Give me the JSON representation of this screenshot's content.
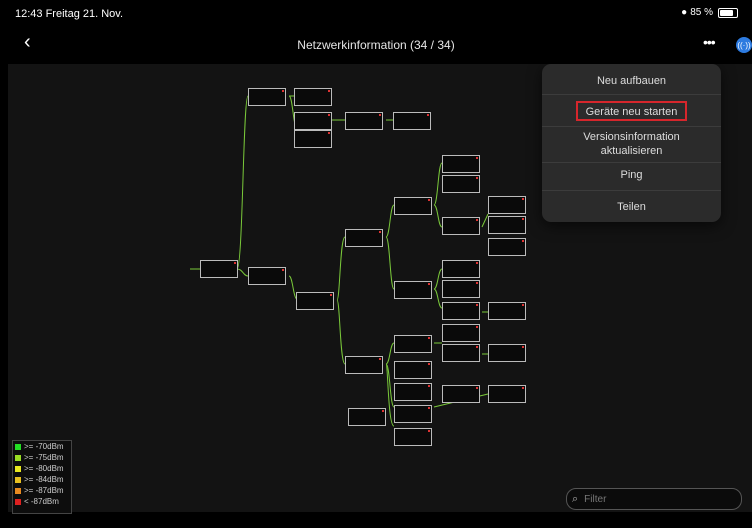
{
  "status_bar": {
    "time_date": "12:43  Freitag 21. Nov.",
    "battery": "85 %"
  },
  "header": {
    "title": "Netzwerkinformation (34 / 34)",
    "back_icon": "chevron-left",
    "more_icon": "ellipsis",
    "signal_icon": "signal"
  },
  "menu": {
    "items": [
      "Neu aufbauen",
      "Geräte neu starten",
      "Versionsinformation aktualisieren",
      "Ping",
      "Teilen"
    ],
    "highlighted": "Geräte neu starten"
  },
  "legend": {
    "entries": [
      {
        "label": ">= -70dBm",
        "color": "#22dd22"
      },
      {
        "label": ">= -75dBm",
        "color": "#99dd22"
      },
      {
        "label": ">= -80dBm",
        "color": "#e8e820"
      },
      {
        "label": ">= -84dBm",
        "color": "#e8c020"
      },
      {
        "label": ">= -87dBm",
        "color": "#e88a20"
      },
      {
        "label": "< -87dBm",
        "color": "#dd2020"
      }
    ]
  },
  "filter": {
    "placeholder": "Filter"
  }
}
